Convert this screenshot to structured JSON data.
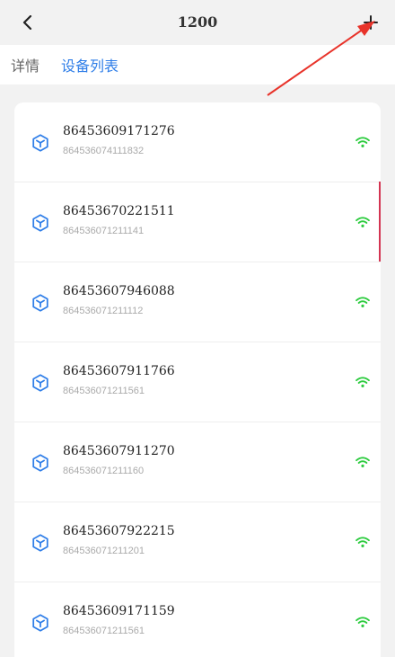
{
  "header": {
    "title": "1200",
    "back_icon": "chevron-left-icon",
    "add_icon": "plus-icon"
  },
  "tabs": [
    {
      "label": "详情",
      "active": false
    },
    {
      "label": "设备列表",
      "active": true
    }
  ],
  "colors": {
    "accent": "#2f7ee8",
    "online": "#2ecc40",
    "annotation": "#e8332a"
  },
  "devices": [
    {
      "title": "86453609171276",
      "subtitle": "864536074111832",
      "icon": "cube-icon",
      "status_icon": "wifi-icon"
    },
    {
      "title": "86453670221511",
      "subtitle": "864536071211141",
      "icon": "cube-icon",
      "status_icon": "wifi-icon"
    },
    {
      "title": "86453607946088",
      "subtitle": "864536071211112",
      "icon": "cube-icon",
      "status_icon": "wifi-icon"
    },
    {
      "title": "86453607911766",
      "subtitle": "864536071211561",
      "icon": "cube-icon",
      "status_icon": "wifi-icon"
    },
    {
      "title": "86453607911270",
      "subtitle": "864536071211160",
      "icon": "cube-icon",
      "status_icon": "wifi-icon"
    },
    {
      "title": "86453607922215",
      "subtitle": "864536071211201",
      "icon": "cube-icon",
      "status_icon": "wifi-icon"
    },
    {
      "title": "86453609171159",
      "subtitle": "864536071211561",
      "icon": "cube-icon",
      "status_icon": "wifi-icon"
    }
  ]
}
